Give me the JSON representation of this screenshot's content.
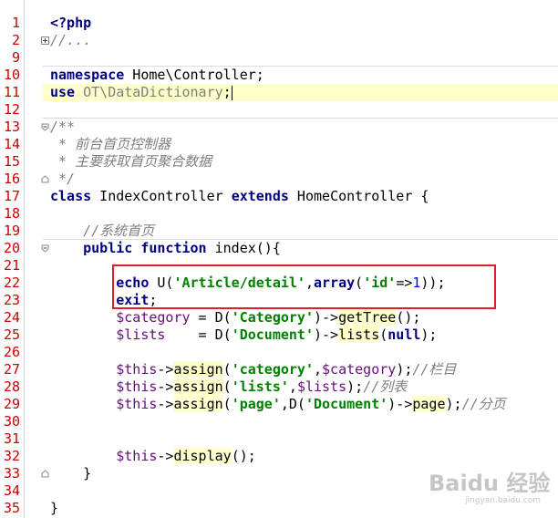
{
  "editor": {
    "language": "php",
    "colors": {
      "line_number": "#cc0000",
      "keyword": "#000080",
      "string": "#008000",
      "comment": "#808080",
      "variable": "#660e7a",
      "current_line": "#ffffcc",
      "annotation_box": "#e02020"
    },
    "lines": [
      {
        "n": "1",
        "html": "<span class=\"kw\">&lt;?php</span>"
      },
      {
        "n": "2",
        "html": "<span class=\"cm\">//...</span>",
        "fold": "plus"
      },
      {
        "n": "9",
        "html": ""
      },
      {
        "n": "10",
        "html": "<span class=\"kw\">namespace</span> Home\\Controller;"
      },
      {
        "n": "11",
        "html": "<span class=\"kw\">use</span> <span class=\"cm\" style=\"font-style:normal;color:#7f7f7f\">OT\\DataDictionary</span>;<span class=\"caret\"></span>",
        "current": true
      },
      {
        "n": "12",
        "html": ""
      },
      {
        "n": "13",
        "html": "<span class=\"cm\">/**</span>",
        "fold": "open"
      },
      {
        "n": "14",
        "html": "<span class=\"cm\"> * 前台首页控制器</span>"
      },
      {
        "n": "15",
        "html": "<span class=\"cm\"> * 主要获取首页聚合数据</span>"
      },
      {
        "n": "16",
        "html": "<span class=\"cm\"> */</span>",
        "fold": "close"
      },
      {
        "n": "17",
        "html": "<span class=\"kw\">class</span> IndexController <span class=\"kw\">extends</span> HomeController {"
      },
      {
        "n": "18",
        "html": ""
      },
      {
        "n": "19",
        "html": "    <span class=\"cm\">//系统首页</span>"
      },
      {
        "n": "20",
        "html": "    <span class=\"kw\">public function</span> index(){",
        "fold": "open"
      },
      {
        "n": "21",
        "html": ""
      },
      {
        "n": "22",
        "html": "        <span class=\"kw\">echo</span> U(<span class=\"str\">'Article/detail'</span>,<span class=\"kw\">array</span>(<span class=\"str\">'id'</span>=&gt;<span class=\"num\">1</span>));"
      },
      {
        "n": "23",
        "html": "        <span class=\"kw\">exit</span>;"
      },
      {
        "n": "24",
        "html": "        <span class=\"var\">$category</span> = D(<span class=\"str\">'Category'</span>)-&gt;<span class=\"call\">getTree</span>();"
      },
      {
        "n": "25",
        "html": "        <span class=\"var\">$lists</span>    = D(<span class=\"str\">'Document'</span>)-&gt;<span class=\"call\">lists</span>(<span class=\"kw\">null</span>);"
      },
      {
        "n": "26",
        "html": ""
      },
      {
        "n": "27",
        "html": "        <span class=\"var\">$this</span>-&gt;<span class=\"call\">assign</span>(<span class=\"str\">'category'</span>,<span class=\"var\">$category</span>);<span class=\"cm\">//栏目</span>"
      },
      {
        "n": "28",
        "html": "        <span class=\"var\">$this</span>-&gt;<span class=\"call\">assign</span>(<span class=\"str\">'lists'</span>,<span class=\"var\">$lists</span>);<span class=\"cm\">//列表</span>"
      },
      {
        "n": "29",
        "html": "        <span class=\"var\">$this</span>-&gt;<span class=\"call\">assign</span>(<span class=\"str\">'page'</span>,D(<span class=\"str\">'Document'</span>)-&gt;<span class=\"call\">page</span>);<span class=\"cm\">//分页</span>"
      },
      {
        "n": "30",
        "html": ""
      },
      {
        "n": "31",
        "html": ""
      },
      {
        "n": "32",
        "html": "        <span class=\"var\">$this</span>-&gt;<span class=\"call\">display</span>();"
      },
      {
        "n": "33",
        "html": "    }",
        "fold": "close"
      },
      {
        "n": "34",
        "html": ""
      },
      {
        "n": "35",
        "html": "}"
      }
    ]
  },
  "watermark": {
    "main": "Baidu 经验",
    "sub": "jingyan.baidu.com"
  }
}
